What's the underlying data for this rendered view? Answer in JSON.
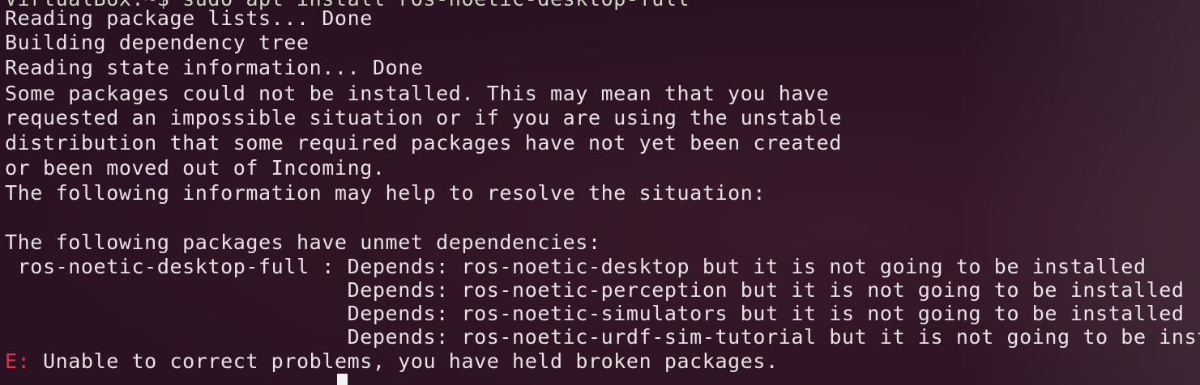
{
  "terminal": {
    "lines": [
      "Reading package lists... Done",
      "Building dependency tree",
      "Reading state information... Done",
      "Some packages could not be installed. This may mean that you have",
      "requested an impossible situation or if you are using the unstable",
      "distribution that some required packages have not yet been created",
      "or been moved out of Incoming.",
      "The following information may help to resolve the situation:",
      "The following packages have unmet dependencies:",
      " ros-noetic-desktop-full : Depends: ros-noetic-desktop but it is not going to be installed",
      "                           Depends: ros-noetic-perception but it is not going to be installed",
      "                           Depends: ros-noetic-simulators but it is not going to be installed",
      "                           Depends: ros-noetic-urdf-sim-tutorial but it is not going to be installed"
    ],
    "top_prompt_fragment": "VirtualBox:~$ sudo apt install ros-noetic-desktop-full",
    "error_marker": "E:",
    "error_message": " Unable to correct problems, you have held broken packages."
  },
  "colors": {
    "background": "#2f1424",
    "text": "#e9e2e6",
    "prompt_user": "#7fcf3a",
    "prompt_path": "#6d8fd6",
    "error_marker": "#e0364a"
  }
}
